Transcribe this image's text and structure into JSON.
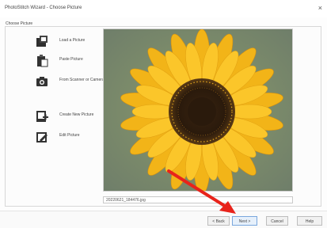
{
  "window": {
    "title": "PhotoStitch Wizard - Choose Picture",
    "section_label": "Choose Picture",
    "close_label": "×"
  },
  "actions": [
    {
      "name": "load-picture",
      "label": "Load a Picture",
      "icon": "open-file-icon"
    },
    {
      "name": "paste-picture",
      "label": "Paste Picture",
      "icon": "paste-icon"
    },
    {
      "name": "from-scanner-camera",
      "label": "From Scanner or Camera",
      "icon": "camera-icon"
    },
    {
      "name": "create-new-picture",
      "label": "Create New Picture",
      "icon": "new-picture-icon"
    },
    {
      "name": "edit-picture",
      "label": "Edit Picture",
      "icon": "edit-picture-icon"
    }
  ],
  "preview": {
    "filename": "20220621_184476.jpg"
  },
  "buttons": {
    "back": "< Back",
    "next": "Next >",
    "cancel": "Cancel",
    "help": "Help"
  },
  "colors": {
    "arrow": "#e8231b",
    "accent": "#7aa7dd"
  }
}
